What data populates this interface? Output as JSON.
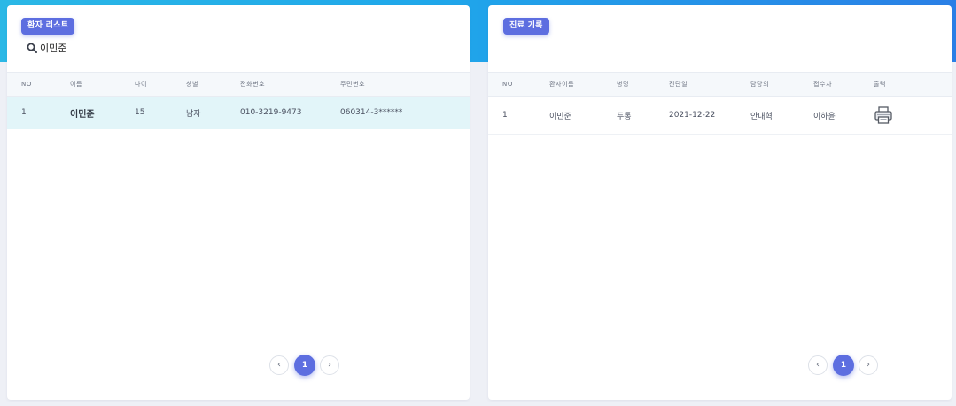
{
  "colors": {
    "accent": "#5d6ee0",
    "header_band_start": "#2bb8e6",
    "header_band_end": "#2a7fe6",
    "selected_row": "#e2f5f9"
  },
  "patient_list": {
    "badge": "환자 리스트",
    "search": {
      "value": "이민준",
      "icon": "search-icon"
    },
    "columns": [
      "NO",
      "이름",
      "나이",
      "성별",
      "전화번호",
      "주민번호"
    ],
    "rows": [
      {
        "no": "1",
        "name": "이민준",
        "age": "15",
        "gender": "남자",
        "phone": "010-3219-9473",
        "rrn": "060314-3******"
      }
    ],
    "pagination": {
      "prev": "‹",
      "current": "1",
      "next": "›"
    }
  },
  "treatment_records": {
    "badge": "진료 기록",
    "columns": [
      "NO",
      "환자이름",
      "병명",
      "진단일",
      "담당의",
      "접수자",
      "출력"
    ],
    "rows": [
      {
        "no": "1",
        "patient_name": "이민준",
        "disease": "두통",
        "date": "2021-12-22",
        "doctor": "안대혁",
        "receptionist": "이하윤",
        "print_icon": "printer-icon"
      }
    ],
    "pagination": {
      "prev": "‹",
      "current": "1",
      "next": "›"
    }
  }
}
